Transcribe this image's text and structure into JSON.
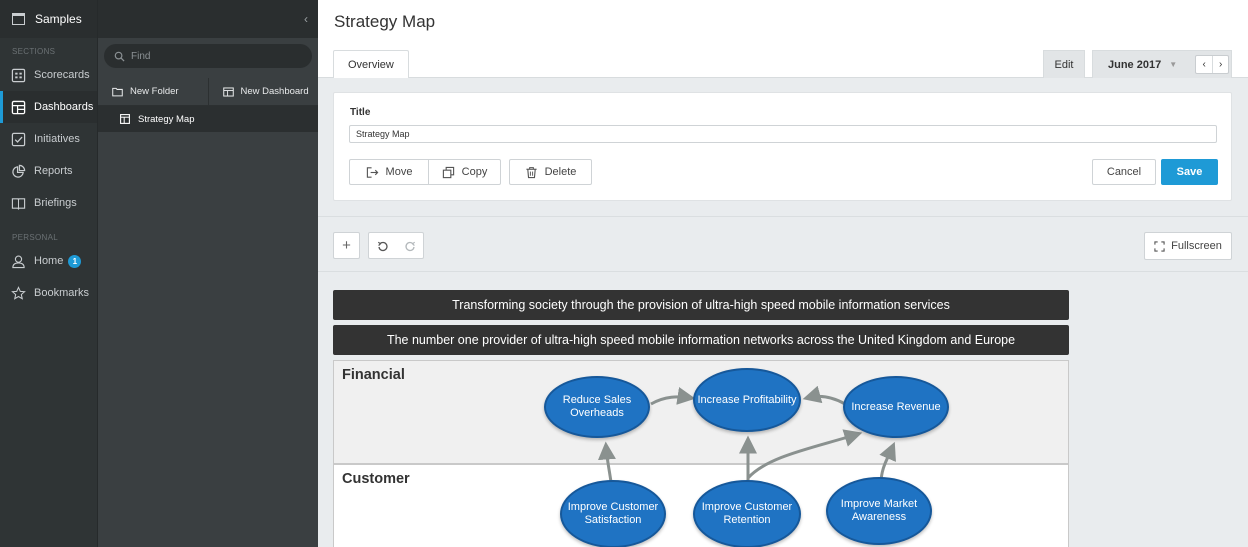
{
  "app": {
    "name": "Samples",
    "collapse_glyph": "‹"
  },
  "leftnav": {
    "sections_label": "SECTIONS",
    "items": [
      {
        "label": "Scorecards",
        "icon": "scorecard-icon"
      },
      {
        "label": "Dashboards",
        "icon": "dashboard-icon",
        "active": true
      },
      {
        "label": "Initiatives",
        "icon": "checkbox-icon"
      },
      {
        "label": "Reports",
        "icon": "pie-chart-icon"
      },
      {
        "label": "Briefings",
        "icon": "book-icon"
      }
    ],
    "personal_label": "PERSONAL",
    "personal_items": [
      {
        "label": "Home",
        "icon": "user-icon",
        "badge": "1"
      },
      {
        "label": "Bookmarks",
        "icon": "star-icon"
      }
    ]
  },
  "midpanel": {
    "search_placeholder": "Find",
    "new_folder": "New Folder",
    "new_dashboard": "New Dashboard",
    "items": [
      {
        "label": "Strategy Map",
        "icon": "dashboard-icon",
        "selected": true
      }
    ]
  },
  "main": {
    "title": "Strategy Map",
    "tab": "Overview",
    "edit_tab": "Edit",
    "period": "June 2017",
    "period_caret": "▼",
    "prev": "‹",
    "next": "›",
    "form": {
      "title_label": "Title",
      "title_value": "Strategy Map",
      "move": "Move",
      "copy": "Copy",
      "delete": "Delete",
      "cancel": "Cancel",
      "save": "Save"
    },
    "toolbar": {
      "add": "+",
      "fullscreen": "Fullscreen"
    },
    "colors": {
      "accent": "#1e9ad6",
      "objective_fill": "#1f73c3",
      "banner": "#333333"
    }
  },
  "strategy_map": {
    "vision": "Transforming society through the provision of ultra-high speed mobile information services",
    "mission": "The number one provider of ultra-high speed mobile information networks across the United Kingdom and Europe",
    "perspectives": [
      {
        "name": "Financial",
        "objectives": [
          "Reduce Sales Overheads",
          "Increase Profitability",
          "Increase Revenue"
        ]
      },
      {
        "name": "Customer",
        "objectives": [
          "Improve Customer Satisfaction",
          "Improve Customer Retention",
          "Improve Market Awareness"
        ]
      }
    ]
  }
}
